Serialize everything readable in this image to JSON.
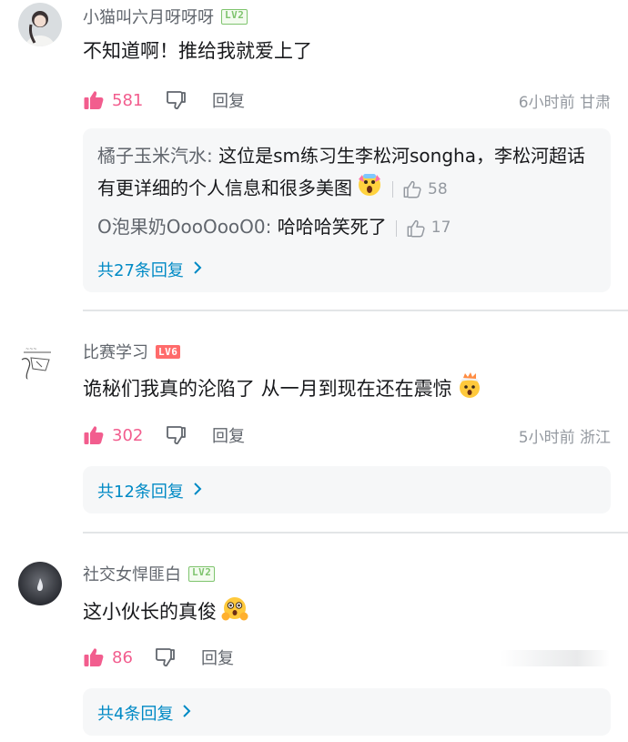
{
  "comments": [
    {
      "username": "小猫叫六月呀呀呀",
      "level": "LV2",
      "content": "不知道啊！推给我就爱上了",
      "likes": "581",
      "reply_label": "回复",
      "meta": "6小时前 甘肃",
      "sub_replies": [
        {
          "user": "橘子玉米汽水",
          "separator": ": ",
          "text": "这位是sm练习生李松河songha，李松河超话有更详细的个人信息和很多美图",
          "likes": "58",
          "emoji": "scream-emoji"
        },
        {
          "user": "O泡果奶OooOooO0",
          "separator": ": ",
          "text": "哈哈哈笑死了",
          "likes": "17"
        }
      ],
      "more_replies": "共27条回复"
    },
    {
      "username": "比赛学习",
      "level": "LV6",
      "content": "诡秘们我真的沦陷了 从一月到现在还在震惊",
      "emoji": "exploding-head-emoji",
      "likes": "302",
      "reply_label": "回复",
      "meta": "5小时前 浙江",
      "more_replies": "共12条回复"
    },
    {
      "username": "社交女悍匪白",
      "level": "LV2",
      "content": "这小伙长的真俊",
      "emoji": "flushed-hands-emoji",
      "likes": "86",
      "reply_label": "回复",
      "more_replies": "共4条回复"
    }
  ],
  "colors": {
    "like": "#f25d8e",
    "link": "#008ac5",
    "muted": "#9499a0",
    "reply_box_bg": "#f6f7f8"
  }
}
